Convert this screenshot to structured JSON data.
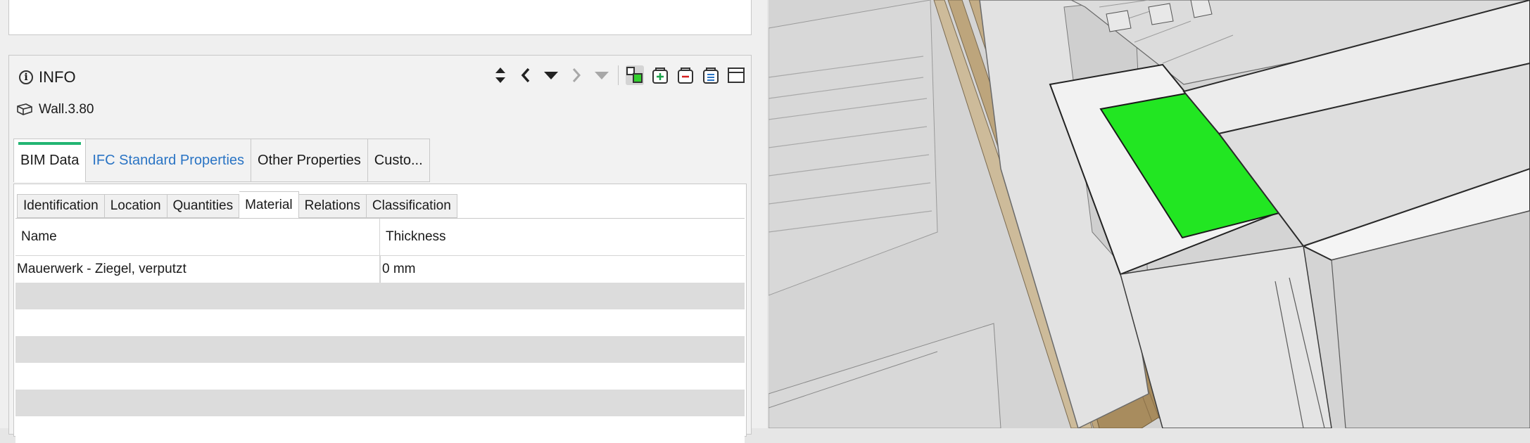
{
  "info_panel": {
    "title": "INFO",
    "object_name": "Wall.3.80"
  },
  "main_tabs": [
    {
      "label": "BIM Data",
      "active": true
    },
    {
      "label": "IFC Standard Properties",
      "active": false
    },
    {
      "label": "Other Properties",
      "active": false
    },
    {
      "label": "Custo...",
      "active": false
    }
  ],
  "sub_tabs": [
    {
      "label": "Identification"
    },
    {
      "label": "Location"
    },
    {
      "label": "Quantities"
    },
    {
      "label": "Material",
      "active": true
    },
    {
      "label": "Relations"
    },
    {
      "label": "Classification"
    }
  ],
  "table": {
    "headers": [
      "Name",
      "Thickness"
    ],
    "rows": [
      [
        "Mauerwerk - Ziegel, verputzt",
        "0 mm"
      ]
    ]
  },
  "colors": {
    "accent": "#22b573",
    "link": "#2a74c4",
    "highlight": "#22e622"
  },
  "icons": [
    "info-icon",
    "sort-icon",
    "chevron-left-icon",
    "triangle-down-icon",
    "chevron-right-icon",
    "triangle-down-icon",
    "xray-cubes-icon",
    "add-selection-icon",
    "remove-selection-icon",
    "list-selection-icon",
    "window-icon",
    "wall-icon"
  ]
}
